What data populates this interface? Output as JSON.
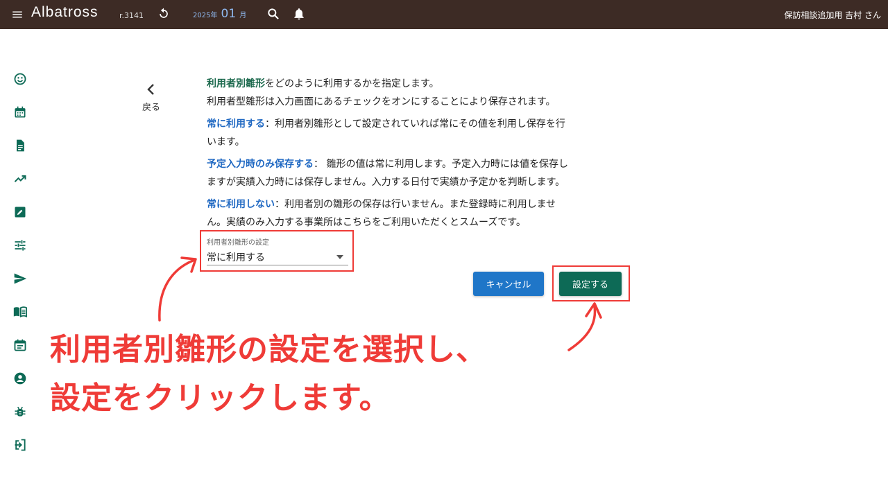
{
  "header": {
    "app_name": "Albatross",
    "revision": "r.3141",
    "date_year": "2025年",
    "date_month": "01",
    "date_month_unit": "月",
    "user": "保訪相談追加用 吉村 さん"
  },
  "sidebar": {
    "icons": [
      "face-icon",
      "calendar-icon",
      "document-icon",
      "trending-up-icon",
      "edit-icon",
      "tune-icon",
      "send-icon",
      "book-icon",
      "event-icon",
      "account-icon",
      "bug-icon",
      "login-icon"
    ]
  },
  "back": {
    "label": "戻る"
  },
  "description": {
    "line1_term": "利用者別雛形",
    "line1_rest": "をどのように利用するかを指定します。",
    "line2": "利用者型雛形は入力画面にあるチェックをオンにすることにより保存されます。",
    "opt1_term": "常に利用する",
    "opt1_text": "：利用者別雛形として設定されていれば常にその値を利用し保存を行",
    "opt1_text2": "います。",
    "opt2_term": "予定入力時のみ保存する",
    "opt2_text": "： 雛形の値は常に利用します。予定入力時には値を保存し",
    "opt2_text2": "ますが実績入力時には保存しません。入力する日付で実績か予定かを判断します。",
    "opt3_term": "常に利用しない",
    "opt3_text": "：利用者別の雛形の保存は行いません。また登録時に利用しませ",
    "opt3_text2": "ん。実績のみ入力する事業所はこちらをご利用いただくとスムーズです。"
  },
  "select": {
    "label": "利用者別雛形の設定",
    "value": "常に利用する"
  },
  "buttons": {
    "cancel": "キャンセル",
    "submit": "設定する"
  },
  "annotation": {
    "line1": "利用者別雛形の設定を選択し、",
    "line2": "設定をクリックします。"
  },
  "colors": {
    "header_bg": "#3d2b25",
    "sidebar_icon": "#0d6a56",
    "cancel_btn": "#1f76c8",
    "submit_btn": "#0d6a56",
    "highlight": "#ef3b37"
  }
}
